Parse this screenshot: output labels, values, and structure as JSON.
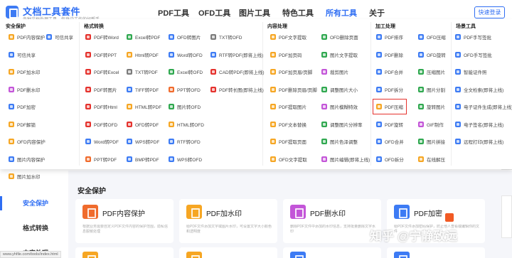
{
  "brand": {
    "title": "文档工具套件",
    "subtitle": "各种文档处理工具，你身边工作的好帮手"
  },
  "nav": [
    {
      "label": "PDF工具"
    },
    {
      "label": "OFD工具"
    },
    {
      "label": "图片工具"
    },
    {
      "label": "特色工具"
    },
    {
      "label": "所有工具"
    },
    {
      "label": "关于"
    }
  ],
  "login": "快速登录",
  "dropdown": {
    "categories": [
      "安全保护",
      "格式转换",
      "内容处理",
      "加工处理",
      "场景工具"
    ],
    "tools": [
      {
        "label": "PDF内容保护",
        "color": "#f6a623"
      },
      {
        "label": "可信共享",
        "color": "#3d7bf4"
      },
      {
        "label": "PDF加水印",
        "color": "#f6a623"
      },
      {
        "label": "PDF删水印",
        "color": "#c355d8"
      },
      {
        "label": "PDF加密",
        "color": "#3d7bf4"
      },
      {
        "label": "PDF解锁",
        "color": "#f6a623"
      },
      {
        "label": "OFD内容保护",
        "color": "#f6a623"
      },
      {
        "label": "图片内容保护",
        "color": "#3d7bf4"
      },
      {
        "label": "图片加水印",
        "color": "#f6a623"
      },
      {
        "label": "PDF转Word",
        "color": "#e5322d"
      },
      {
        "label": "PDF转PPT",
        "color": "#e5322d"
      },
      {
        "label": "PDF转Excel",
        "color": "#e5322d"
      },
      {
        "label": "PDF转图片",
        "color": "#e5322d"
      },
      {
        "label": "PDF转Html",
        "color": "#e5322d"
      },
      {
        "label": "PDF转OFD",
        "color": "#e5322d"
      },
      {
        "label": "Word转PDF",
        "color": "#3d7bf4"
      },
      {
        "label": "PPT转PDF",
        "color": "#f06b2c"
      },
      {
        "label": "Excel转PDF",
        "color": "#2fa84f"
      },
      {
        "label": "Html转PDF",
        "color": "#f6a623"
      },
      {
        "label": "TXT转PDF",
        "color": "#7b7b7b"
      },
      {
        "label": "TIFF转PDF",
        "color": "#3d7bf4"
      },
      {
        "label": "HTML转PDF",
        "color": "#f6a623"
      },
      {
        "label": "OFD转PDF",
        "color": "#e5322d"
      },
      {
        "label": "WPS转PDF",
        "color": "#3d7bf4"
      },
      {
        "label": "BMP转PDF",
        "color": "#3d7bf4"
      },
      {
        "label": "OFD转图片",
        "color": "#3d7bf4"
      },
      {
        "label": "Word转OFD",
        "color": "#3d7bf4"
      },
      {
        "label": "Excel转OFD",
        "color": "#2fa84f"
      },
      {
        "label": "PPT转OFD",
        "color": "#f06b2c"
      },
      {
        "label": "图片转OFD",
        "color": "#2fa84f"
      },
      {
        "label": "HTML转OFD",
        "color": "#f6a623"
      },
      {
        "label": "RTF转OFD",
        "color": "#3d7bf4"
      },
      {
        "label": "WPS转OFD",
        "color": "#3d7bf4"
      },
      {
        "label": "TXT转OFD",
        "color": "#7b7b7b"
      },
      {
        "label": "RTF转PDF(即将上线)",
        "color": "#3d7bf4"
      },
      {
        "label": "CAD转PDF(即将上线)",
        "color": "#e5322d"
      },
      {
        "label": "PDF转长图(即将上线)",
        "color": "#e5322d"
      },
      {
        "label": "PDF文字提取",
        "color": "#f6a623"
      },
      {
        "label": "PDF加页码",
        "color": "#f6a623"
      },
      {
        "label": "PDF加页眉/页脚",
        "color": "#f6a623"
      },
      {
        "label": "PDF删除页眉/页脚",
        "color": "#f6a623"
      },
      {
        "label": "PDF提取图片",
        "color": "#f6a623"
      },
      {
        "label": "PDF文本替换",
        "color": "#f6a623"
      },
      {
        "label": "PDF提取页面",
        "color": "#f6a623"
      },
      {
        "label": "OFD文字提取",
        "color": "#f6a623"
      },
      {
        "label": "OFD删除页面",
        "color": "#2fa84f"
      },
      {
        "label": "图片文字提取",
        "color": "#2fa84f"
      },
      {
        "label": "裁剪图片",
        "color": "#c355d8"
      },
      {
        "label": "调整图片大小",
        "color": "#2fa84f"
      },
      {
        "label": "图片模糊特效",
        "color": "#c355d8"
      },
      {
        "label": "调整图片分辨率",
        "color": "#2fa84f"
      },
      {
        "label": "图片色泽调整",
        "color": "#2fa84f"
      },
      {
        "label": "图片编辑(即将上线)",
        "color": "#c355d8"
      },
      {
        "label": "PDF排序",
        "color": "#3d7bf4"
      },
      {
        "label": "PDF删除",
        "color": "#3d7bf4"
      },
      {
        "label": "PDF合并",
        "color": "#3d7bf4"
      },
      {
        "label": "PDF拆分",
        "color": "#3d7bf4"
      },
      {
        "label": "PDF压缩",
        "color": "#f6a623"
      },
      {
        "label": "PDF旋转",
        "color": "#3d7bf4"
      },
      {
        "label": "OFD合并",
        "color": "#3d7bf4"
      },
      {
        "label": "OFD拆分",
        "color": "#3d7bf4"
      },
      {
        "label": "OFD压缩",
        "color": "#3d7bf4"
      },
      {
        "label": "OFD旋转",
        "color": "#3d7bf4"
      },
      {
        "label": "压缩图片",
        "color": "#2fa84f"
      },
      {
        "label": "图片分割",
        "color": "#2fa84f"
      },
      {
        "label": "旋转图片",
        "color": "#2fa84f"
      },
      {
        "label": "GIF制作",
        "color": "#c355d8"
      },
      {
        "label": "图片拼接",
        "color": "#2fa84f"
      },
      {
        "label": "在线解压",
        "color": "#f6a623"
      },
      {
        "label": "PDF手写签批",
        "color": "#3d7bf4"
      },
      {
        "label": "OFD手写签批",
        "color": "#3d7bf4"
      },
      {
        "label": "智能证件照",
        "color": "#3d7bf4"
      },
      {
        "label": "全文检索(即将上线)",
        "color": "#3d7bf4"
      },
      {
        "label": "电子证件生成(即将上线)",
        "color": "#3d7bf4"
      },
      {
        "label": "电子签名(即将上线)",
        "color": "#3d7bf4"
      },
      {
        "label": "远程打印(即将上线)",
        "color": "#3d7bf4"
      }
    ]
  },
  "sidebar": {
    "items": [
      {
        "label": "安全保护"
      },
      {
        "label": "格式转换"
      },
      {
        "label": "内容处理"
      }
    ]
  },
  "section": {
    "title": "安全保护"
  },
  "cards": [
    {
      "title": "PDF内容保护",
      "desc": "根据业务需要自定义PDF文件内容的保护范围，隐私信息脱敏处理",
      "color": "#f06b2c"
    },
    {
      "title": "PDF加水印",
      "desc": "给PDF文件添加文字或图片水印，可设置文字大小颜色和透明度",
      "color": "#f6a623"
    },
    {
      "title": "PDF删水印",
      "desc": "删除PDF文件中添加的水印信息，支持批量删除文字水印",
      "color": "#c355d8"
    },
    {
      "title": "PDF加密",
      "desc": "给PDF文件添加密码保护，防止他人查看或编辑你的文件",
      "color": "#3d7bf4"
    }
  ],
  "watermark": "知乎 @宁静致远",
  "status_url": "www.yhfile.com/tools/index.html"
}
